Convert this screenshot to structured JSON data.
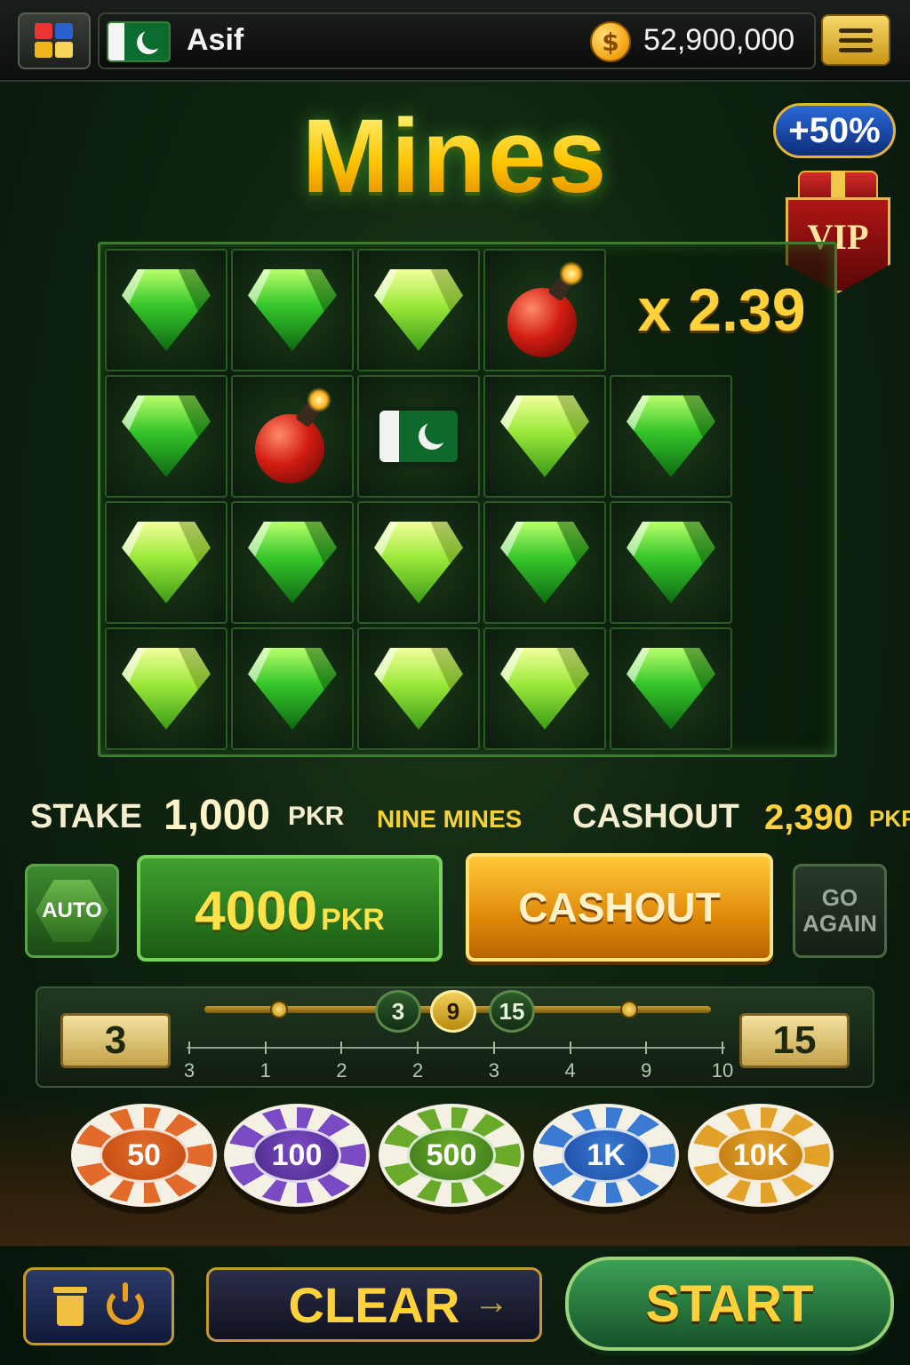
{
  "header": {
    "player_name": "Asif",
    "coin_balance": "52,900,000",
    "icons": [
      "apps-icon",
      "pakistan-flag-icon",
      "coin-icon",
      "menu-list-icon"
    ]
  },
  "game": {
    "title": "Mines",
    "bonus": "+50%",
    "vip": "VIP",
    "multiplier": "x 2.39",
    "grid": {
      "rows": 4,
      "cols": 6,
      "tiles": [
        [
          "gem",
          "gem",
          "gem-bright",
          "bomb",
          "multiplier",
          null
        ],
        [
          "gem",
          "bomb",
          "flag",
          "gem-bright",
          "gem",
          null
        ],
        [
          "gem-bright",
          "gem",
          "gem-bright",
          "gem",
          "gem",
          null
        ],
        [
          "gem-bright",
          "gem",
          "gem-bright",
          "gem-bright",
          "gem",
          null
        ]
      ]
    }
  },
  "info": {
    "stake_label": "STAKE",
    "stake_value": "1,000",
    "stake_unit": "PKR",
    "mines_label": "NINE MINES",
    "cashout_label": "CASHOUT",
    "cashout_value": "2,390",
    "cashout_unit": "PKR"
  },
  "actions": {
    "auto": "AUTO",
    "bet_amount": "4000",
    "bet_unit": "PKR",
    "cashout": "CASHOUT",
    "go_again": "GO AGAIN"
  },
  "mines_selector": {
    "min": "3",
    "max": "15",
    "options": [
      "3",
      "9",
      "15"
    ],
    "selected": "9",
    "scale": [
      "3",
      "1",
      "2",
      "2",
      "3",
      "4",
      "9",
      "10"
    ]
  },
  "chips": [
    {
      "label": "50",
      "color": "#c24a10",
      "ring": "#e26a2a"
    },
    {
      "label": "100",
      "color": "#4a2a8a",
      "ring": "#7a4ac2"
    },
    {
      "label": "500",
      "color": "#3a7a1a",
      "ring": "#6aaa2a"
    },
    {
      "label": "1K",
      "color": "#1a4aa2",
      "ring": "#3a7ad2"
    },
    {
      "label": "10K",
      "color": "#c27a10",
      "ring": "#e2a22a"
    }
  ],
  "footer": {
    "clear": "CLEAR",
    "start": "START"
  }
}
